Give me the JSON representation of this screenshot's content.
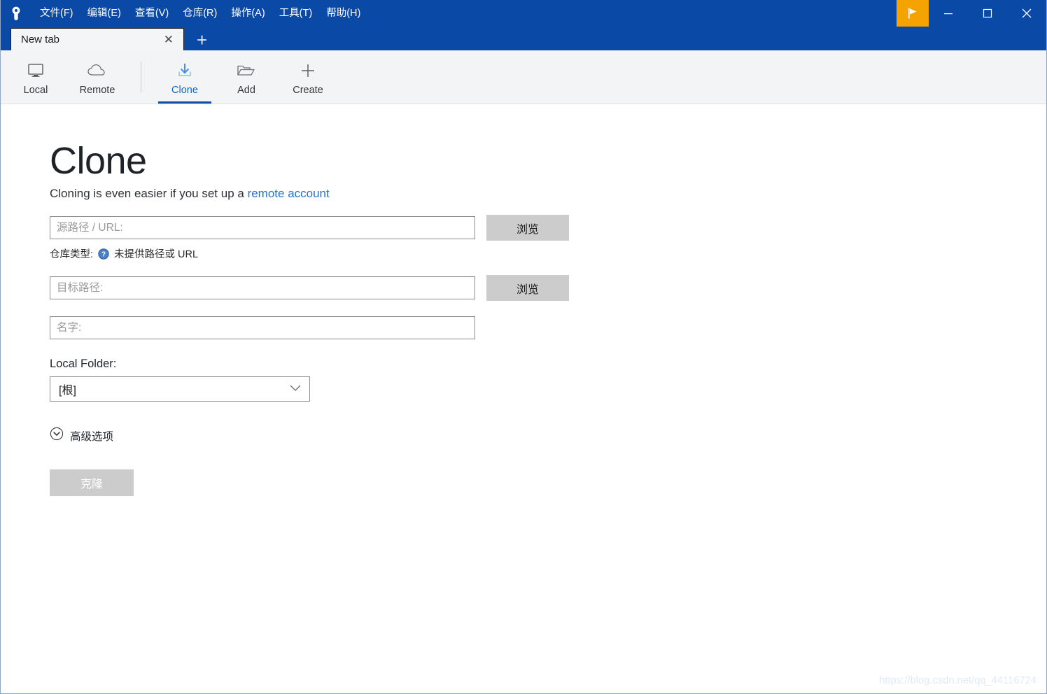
{
  "window": {
    "logo_icon": "sourcetree-keyhole-icon",
    "menu": [
      {
        "label": "文件(F)",
        "name": "menu-file"
      },
      {
        "label": "编辑(E)",
        "name": "menu-edit"
      },
      {
        "label": "查看(V)",
        "name": "menu-view"
      },
      {
        "label": "仓库(R)",
        "name": "menu-repository"
      },
      {
        "label": "操作(A)",
        "name": "menu-actions"
      },
      {
        "label": "工具(T)",
        "name": "menu-tools"
      },
      {
        "label": "帮助(H)",
        "name": "menu-help"
      }
    ],
    "controls": {
      "flag_icon": "flag-icon",
      "flag_color": "#f5a300",
      "minimize": "─",
      "maximize": "□",
      "close": "✕"
    },
    "titlebar_color": "#0a4aa6"
  },
  "tabs": {
    "items": [
      {
        "title": "New tab",
        "close_label": "✕"
      }
    ],
    "new_tab_label": "+"
  },
  "toolbar": {
    "groups": [
      {
        "buttons": [
          {
            "label": "Local",
            "icon": "monitor-icon",
            "active": false
          },
          {
            "label": "Remote",
            "icon": "cloud-icon",
            "active": false
          }
        ]
      },
      {
        "buttons": [
          {
            "label": "Clone",
            "icon": "download-arrow-icon",
            "active": true
          },
          {
            "label": "Add",
            "icon": "folder-open-icon",
            "active": false
          },
          {
            "label": "Create",
            "icon": "plus-icon",
            "active": false
          }
        ]
      }
    ],
    "active_color": "#1565c0",
    "underline_color": "#0f4ca8"
  },
  "main": {
    "title": "Clone",
    "subtitle_prefix": "Cloning is even easier if you set up a ",
    "subtitle_link": "remote account",
    "link_color": "#2a72c8",
    "source": {
      "placeholder": "源路径 / URL:",
      "value": "",
      "browse_label": "浏览"
    },
    "repo_type": {
      "label": "仓库类型:",
      "icon": "help-question-icon",
      "status": "未提供路径或 URL"
    },
    "destination": {
      "placeholder": "目标路径:",
      "value": "",
      "browse_label": "浏览"
    },
    "name": {
      "placeholder": "名字:",
      "value": ""
    },
    "local_folder": {
      "label": "Local Folder:",
      "selected": "[根]",
      "options": [
        "[根]"
      ],
      "chevron_icon": "chevron-down-icon"
    },
    "advanced": {
      "label": "高级选项",
      "icon": "chevron-down-circle-icon"
    },
    "clone_button": {
      "label": "克隆",
      "disabled": true
    }
  },
  "watermark": {
    "text": "https://blog.csdn.net/qq_44116724"
  }
}
